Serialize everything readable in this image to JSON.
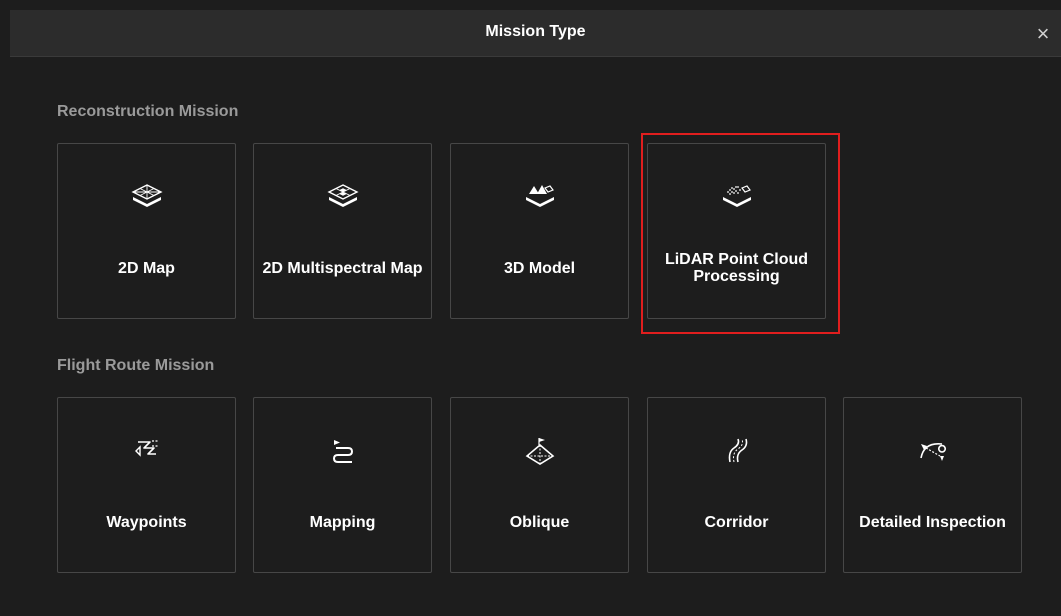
{
  "dialog": {
    "title": "Mission Type",
    "close_glyph": "×"
  },
  "reconstruction": {
    "label": "Reconstruction Mission",
    "items": [
      {
        "label": "2D Map",
        "icon": "2d-map-icon"
      },
      {
        "label": "2D Multispectral Map",
        "icon": "multispectral-map-icon"
      },
      {
        "label": "3D Model",
        "icon": "3d-model-icon"
      },
      {
        "label": "LiDAR Point Cloud Processing",
        "icon": "lidar-point-cloud-icon",
        "selected": true
      }
    ]
  },
  "flight_route": {
    "label": "Flight Route Mission",
    "items": [
      {
        "label": "Waypoints",
        "icon": "waypoints-icon"
      },
      {
        "label": "Mapping",
        "icon": "mapping-route-icon"
      },
      {
        "label": "Oblique",
        "icon": "oblique-icon"
      },
      {
        "label": "Corridor",
        "icon": "corridor-icon"
      },
      {
        "label": "Detailed Inspection",
        "icon": "detailed-inspection-icon"
      }
    ]
  },
  "colors": {
    "background": "#1d1d1d",
    "titlebar": "#2c2c2c",
    "card_border": "#474747",
    "section_label": "#9a9a9a",
    "selection_outline": "#e01e1e"
  }
}
